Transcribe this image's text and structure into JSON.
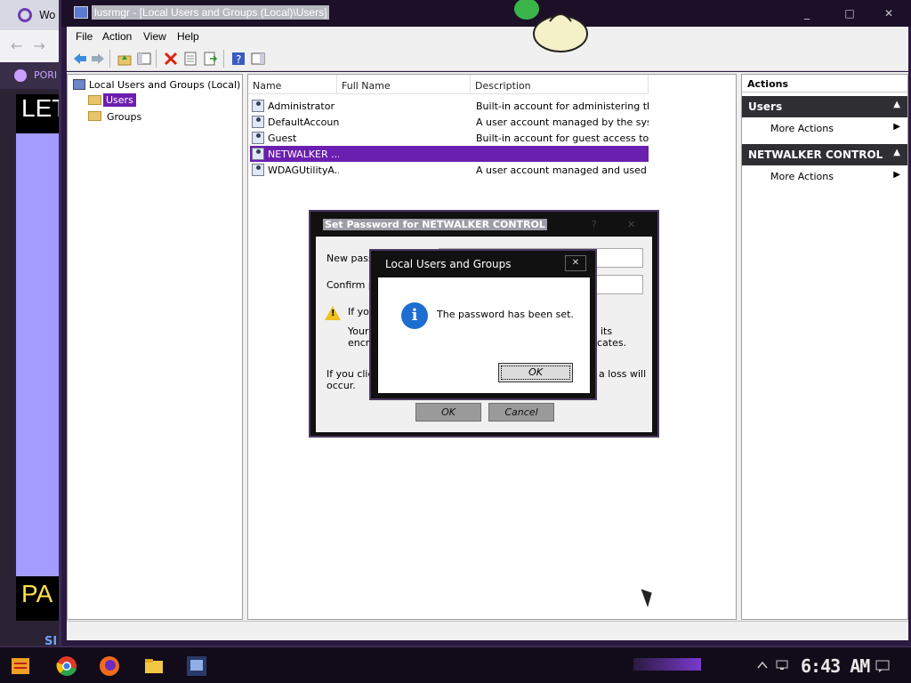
{
  "background_browser": {
    "tab_label": "Wo",
    "bookmark_label": "PORI",
    "page_heading_top": "LET",
    "page_heading_bottom": "PA",
    "page_small_text": "SI"
  },
  "window": {
    "title": "lusrmgr - [Local Users and Groups (Local)\\Users]",
    "controls": {
      "minimize": "_",
      "maximize": "□",
      "close": "✕"
    }
  },
  "menu": [
    "File",
    "Action",
    "View",
    "Help"
  ],
  "toolbar_icons": [
    "back-arrow-icon",
    "forward-arrow-icon",
    "up-folder-icon",
    "show-hide-tree-icon",
    "delete-icon",
    "properties-icon",
    "export-list-icon",
    "help-icon",
    "show-hide-action-pane-icon"
  ],
  "tree": {
    "root": "Local Users and Groups (Local)",
    "children": [
      {
        "label": "Users",
        "selected": true
      },
      {
        "label": "Groups",
        "selected": false
      }
    ]
  },
  "list": {
    "columns": [
      "Name",
      "Full Name",
      "Description"
    ],
    "rows": [
      {
        "name": "Administrator",
        "full_name": "",
        "description": "Built-in account for administering the ...",
        "selected": false
      },
      {
        "name": "DefaultAccount",
        "full_name": "",
        "description": "A user account managed by the syst...",
        "selected": false
      },
      {
        "name": "Guest",
        "full_name": "",
        "description": "Built-in account for guest access to th...",
        "selected": false
      },
      {
        "name": "NETWALKER ...",
        "full_name": "",
        "description": "",
        "selected": true
      },
      {
        "name": "WDAGUtilityA...",
        "full_name": "",
        "description": "A user account managed and used b...",
        "selected": false
      }
    ]
  },
  "actions": {
    "header": "Actions",
    "sections": [
      {
        "title": "Users",
        "items": [
          "More Actions"
        ]
      },
      {
        "title": "NETWALKER CONTROL",
        "items": [
          "More Actions"
        ]
      }
    ]
  },
  "set_password_dialog": {
    "title": "Set Password for NETWALKER CONTROL",
    "new_password_label": "New passw",
    "confirm_password_label": "Confirm pa",
    "warning_line1": "If you",
    "warning_line2a": "Your",
    "warning_line2b": "its",
    "warning_line3a": "encry",
    "warning_line3b": "ificates.",
    "footer_line1a": "If you click",
    "footer_line1b": "a loss will",
    "footer_line2": "occur.",
    "ok_label": "OK",
    "cancel_label": "Cancel"
  },
  "message_box": {
    "title": "Local Users and Groups",
    "message": "The password has been set.",
    "ok_label": "OK",
    "close_label": "✕"
  },
  "taskbar": {
    "apps": [
      "start-icon",
      "chrome-icon",
      "firefox-icon",
      "file-explorer-icon",
      "lusrmgr-taskbar-icon"
    ],
    "clock": "6:43 AM"
  },
  "colors": {
    "selection": "#6b1fb1",
    "info_icon": "#1e6ed1",
    "action_section_bg": "#2f2f33"
  }
}
